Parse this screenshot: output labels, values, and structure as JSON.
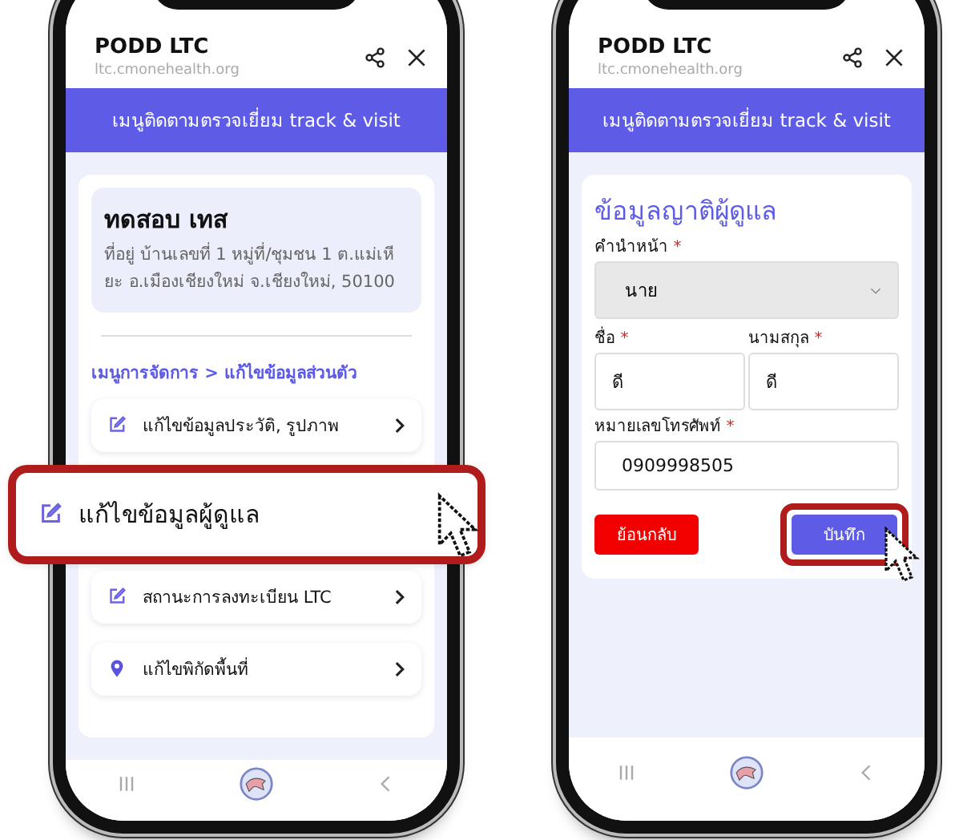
{
  "phones": [
    {
      "browser": {
        "title": "PODD LTC",
        "url": "ltc.cmonehealth.org"
      },
      "banner": "เมนูติดตามตรวจเยี่ยม track & visit",
      "kind": "menu",
      "patient": {
        "name": "ทดสอบ เทส",
        "address": "ที่อยู่ บ้านเลขที่ 1 หมู่ที่/ชุมชน 1 ต.แม่เหียะ อ.เมืองเชียงใหม่ จ.เชียงใหม่, 50100"
      },
      "breadcrumb": "เมนูการจัดการ > แก้ไขข้อมูลส่วนตัว",
      "items": [
        {
          "label": "แก้ไขข้อมูลประวัติ, รูปภาพ",
          "kind": "edit",
          "highlighted": false
        },
        {
          "label": "แก้ไขข้อมูลผู้ดูแล",
          "kind": "edit",
          "highlighted": true
        },
        {
          "label": "สถานะการลงทะเบียน LTC",
          "kind": "edit",
          "highlighted": false
        },
        {
          "label": "แก้ไขพิกัดพื้นที่",
          "kind": "location",
          "highlighted": false
        }
      ]
    },
    {
      "browser": {
        "title": "PODD LTC",
        "url": "ltc.cmonehealth.org"
      },
      "banner": "เมนูติดตามตรวจเยี่ยม track & visit",
      "kind": "form",
      "form": {
        "title": "ข้อมูลญาติผู้ดูแล",
        "prefix": {
          "label": "คำนำหน้า",
          "mark": "*",
          "value": "นาย"
        },
        "names": [
          {
            "label": "ชื่อ",
            "mark": "*",
            "value": "ดี"
          },
          {
            "label": "นามสกุล",
            "mark": "*",
            "value": "ดี"
          }
        ],
        "phone": {
          "label": "หมายเลขโทรศัพท์",
          "mark": "*",
          "value": "0909998505"
        },
        "buttons": [
          {
            "label": "ย้อนกลับ",
            "kind": "back",
            "highlighted": false
          },
          {
            "label": "บันทึก",
            "kind": "save",
            "highlighted": true
          }
        ]
      }
    }
  ]
}
